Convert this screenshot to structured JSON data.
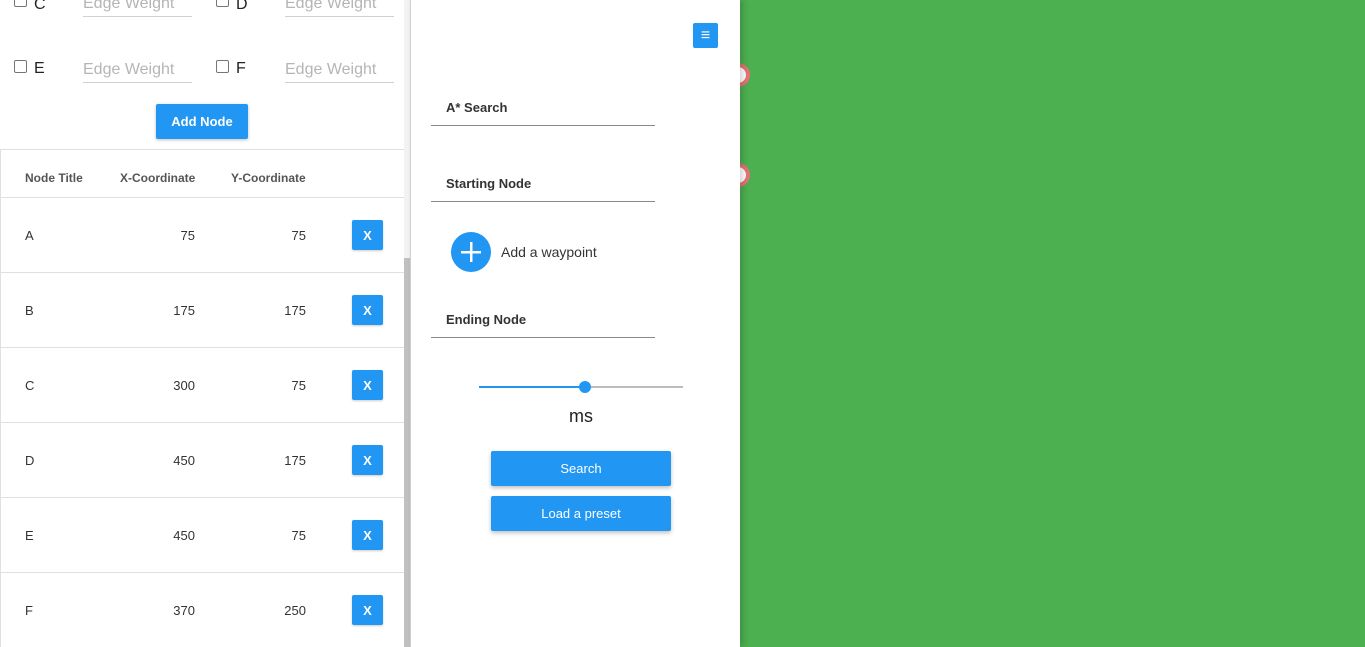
{
  "edges": [
    {
      "letter": "C",
      "placeholder": "Edge Weight"
    },
    {
      "letter": "D",
      "placeholder": "Edge Weight"
    },
    {
      "letter": "E",
      "placeholder": "Edge Weight"
    },
    {
      "letter": "F",
      "placeholder": "Edge Weight"
    }
  ],
  "add_node_label": "Add Node",
  "table": {
    "headers": [
      "Node Title",
      "X-Coordinate",
      "Y-Coordinate"
    ],
    "rows": [
      {
        "title": "A",
        "x": "75",
        "y": "75",
        "delete": "X"
      },
      {
        "title": "B",
        "x": "175",
        "y": "175",
        "delete": "X"
      },
      {
        "title": "C",
        "x": "300",
        "y": "75",
        "delete": "X"
      },
      {
        "title": "D",
        "x": "450",
        "y": "175",
        "delete": "X"
      },
      {
        "title": "E",
        "x": "450",
        "y": "75",
        "delete": "X"
      },
      {
        "title": "F",
        "x": "370",
        "y": "250",
        "delete": "X"
      }
    ]
  },
  "controls": {
    "menu_icon": "≡",
    "algorithm": "A* Search",
    "starting_node": "Starting Node",
    "waypoint_label": "Add a waypoint",
    "ending_node": "Ending Node",
    "speed_fraction": 0.52,
    "speed_unit": "ms",
    "search_label": "Search",
    "preset_label": "Load a preset"
  },
  "colors": {
    "accent": "#2196f3",
    "canvas": "#4caf50",
    "node_border": "#e57373"
  }
}
